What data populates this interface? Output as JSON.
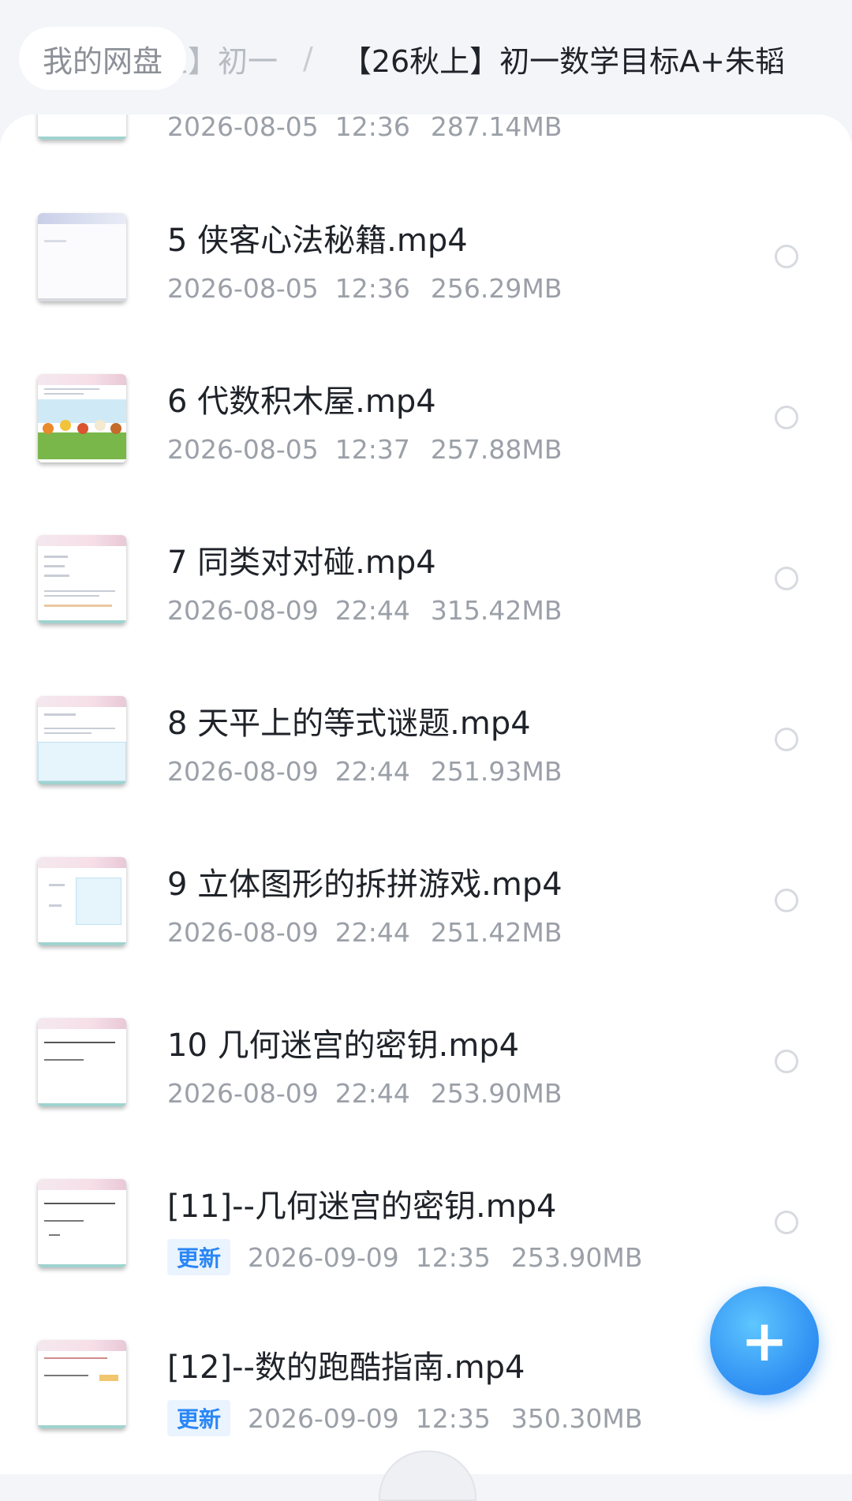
{
  "breadcrumb": {
    "root": "我的网盘",
    "middle": "上】初一",
    "separator": "/",
    "current": "【26秋上】初一数学目标A+朱韬"
  },
  "files": [
    {
      "name": "",
      "date": "2026-08-05",
      "time": "12:36",
      "size": "287.14MB",
      "badge": ""
    },
    {
      "name": "5 侠客心法秘籍.mp4",
      "date": "2026-08-05",
      "time": "12:36",
      "size": "256.29MB",
      "badge": ""
    },
    {
      "name": "6 代数积木屋.mp4",
      "date": "2026-08-05",
      "time": "12:37",
      "size": "257.88MB",
      "badge": ""
    },
    {
      "name": "7 同类对对碰.mp4",
      "date": "2026-08-09",
      "time": "22:44",
      "size": "315.42MB",
      "badge": ""
    },
    {
      "name": "8 天平上的等式谜题.mp4",
      "date": "2026-08-09",
      "time": "22:44",
      "size": "251.93MB",
      "badge": ""
    },
    {
      "name": "9 立体图形的拆拼游戏.mp4",
      "date": "2026-08-09",
      "time": "22:44",
      "size": "251.42MB",
      "badge": ""
    },
    {
      "name": "10 几何迷宫的密钥.mp4",
      "date": "2026-08-09",
      "time": "22:44",
      "size": "253.90MB",
      "badge": ""
    },
    {
      "name": "[11]--几何迷宫的密钥.mp4",
      "date": "2026-09-09",
      "time": "12:35",
      "size": "253.90MB",
      "badge": "更新"
    },
    {
      "name": "[12]--数的跑酷指南.mp4",
      "date": "2026-09-09",
      "time": "12:35",
      "size": "350.30MB",
      "badge": "更新"
    }
  ],
  "fab": {
    "icon": "plus-icon",
    "symbol": "+"
  },
  "colors": {
    "accent": "#2e8ef2",
    "badge_text": "#2a86f5",
    "badge_bg": "#eaf4ff"
  }
}
